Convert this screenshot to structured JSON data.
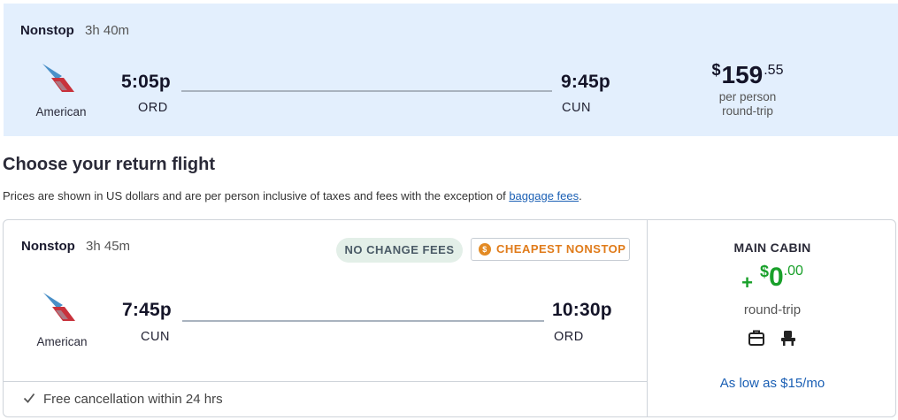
{
  "outbound": {
    "stops": "Nonstop",
    "duration": "3h 40m",
    "airline": "American",
    "depart_time": "5:05p",
    "depart_code": "ORD",
    "arrive_time": "9:45p",
    "arrive_code": "CUN",
    "price": {
      "currency": "$",
      "dollars": "159",
      "cents": ".55",
      "line1": "per person",
      "line2": "round-trip"
    }
  },
  "return_section": {
    "title": "Choose your return flight",
    "disclaimer": "Prices are shown in US dollars and are per person inclusive of taxes and fees with the exception of ",
    "link": "baggage fees",
    "disclaimer_end": "."
  },
  "return_card": {
    "stops": "Nonstop",
    "duration": "3h 45m",
    "badge_no_change": "NO CHANGE FEES",
    "badge_cheapest": "CHEAPEST NONSTOP",
    "airline": "American",
    "depart_time": "7:45p",
    "depart_code": "CUN",
    "arrive_time": "10:30p",
    "arrive_code": "ORD",
    "footer": "Free cancellation within 24 hrs",
    "fare": {
      "cabin": "MAIN CABIN",
      "plus": "+",
      "currency": "$",
      "dollars": "0",
      "cents": ".00",
      "trip": "round-trip",
      "icons": [
        "carry-on-bag-icon",
        "seat-icon"
      ],
      "financing": "As low as $15/mo"
    }
  },
  "colors": {
    "outbound_bg": "#e3effd",
    "fare_green": "#19a02a",
    "link_blue": "#1a5fb4",
    "cheapest_orange": "#e07b1a"
  }
}
